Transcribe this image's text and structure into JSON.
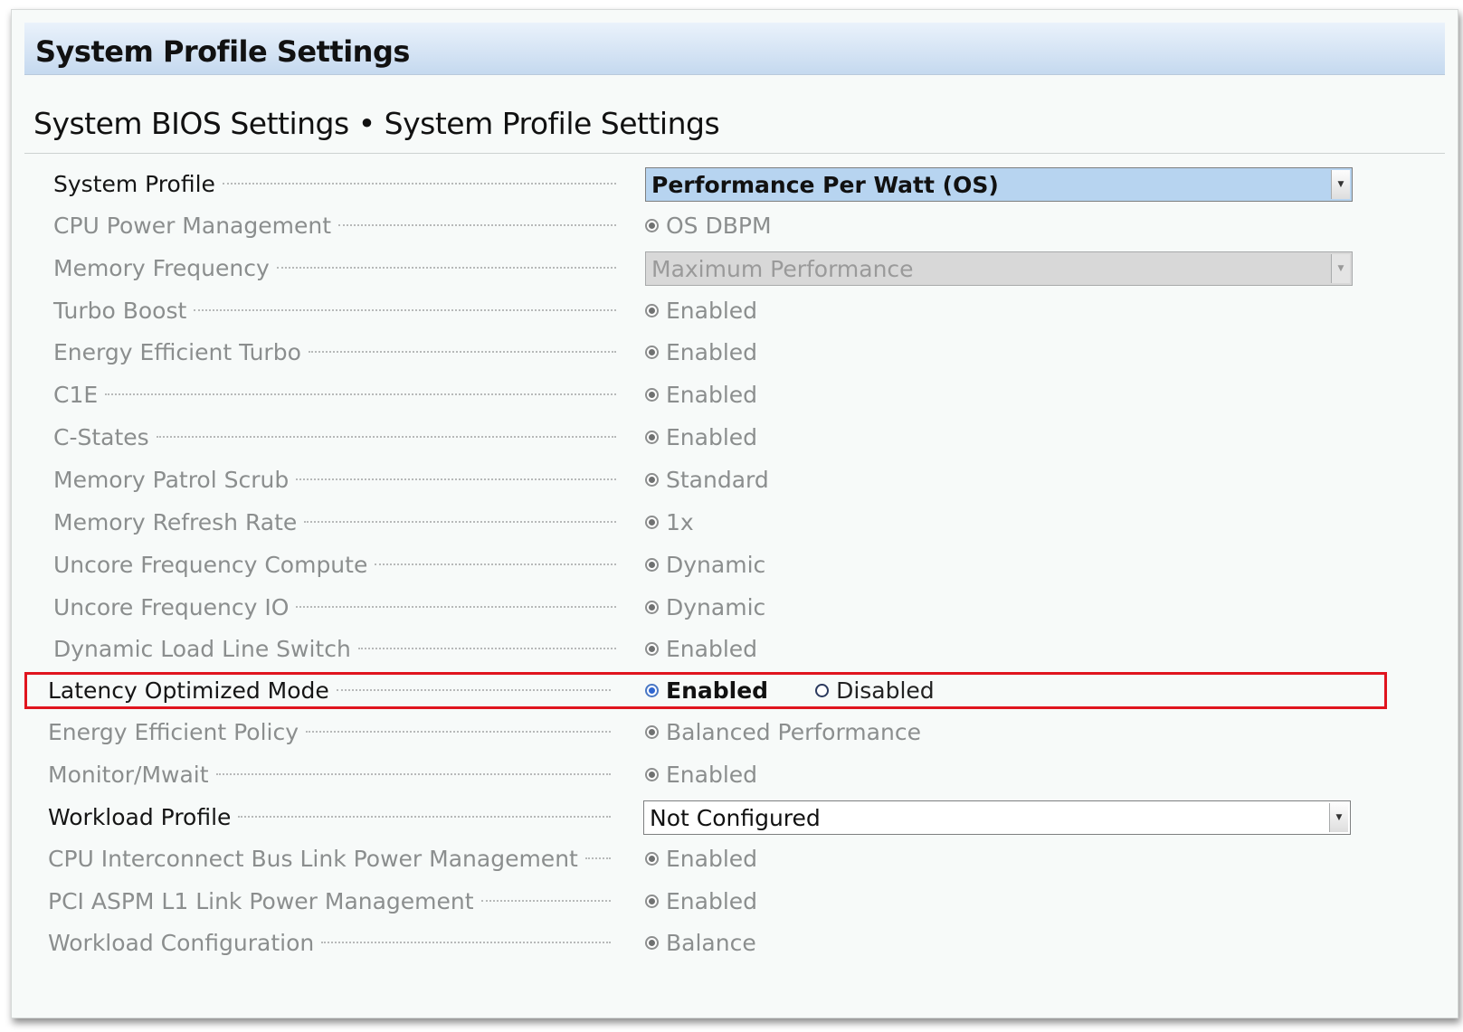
{
  "page": {
    "header_title": "System Profile Settings",
    "breadcrumb": {
      "part1": "System BIOS Settings",
      "separator": "•",
      "part2": "System Profile Settings"
    }
  },
  "settings": {
    "system_profile": {
      "label": "System Profile",
      "value": "Performance Per Watt (OS)"
    },
    "cpu_power_management": {
      "label": "CPU Power Management",
      "value": "OS DBPM"
    },
    "memory_frequency": {
      "label": "Memory Frequency",
      "value": "Maximum Performance"
    },
    "turbo_boost": {
      "label": "Turbo Boost",
      "value": "Enabled"
    },
    "energy_efficient_turbo": {
      "label": "Energy Efficient Turbo",
      "value": "Enabled"
    },
    "c1e": {
      "label": "C1E",
      "value": "Enabled"
    },
    "c_states": {
      "label": "C-States",
      "value": "Enabled"
    },
    "memory_patrol_scrub": {
      "label": "Memory Patrol Scrub",
      "value": "Standard"
    },
    "memory_refresh_rate": {
      "label": "Memory Refresh Rate",
      "value": "1x"
    },
    "uncore_frequency_compute": {
      "label": "Uncore Frequency Compute",
      "value": "Dynamic"
    },
    "uncore_frequency_io": {
      "label": "Uncore Frequency IO",
      "value": "Dynamic"
    },
    "dynamic_load_line_switch": {
      "label": "Dynamic Load Line Switch",
      "value": "Enabled"
    },
    "latency_optimized_mode": {
      "label": "Latency Optimized Mode",
      "option_enabled": "Enabled",
      "option_disabled": "Disabled",
      "selected": "Enabled"
    },
    "energy_efficient_policy": {
      "label": "Energy Efficient Policy",
      "value": "Balanced Performance"
    },
    "monitor_mwait": {
      "label": "Monitor/Mwait",
      "value": "Enabled"
    },
    "workload_profile": {
      "label": "Workload Profile",
      "value": "Not Configured"
    },
    "cpu_interconnect_bus_link_pm": {
      "label": "CPU Interconnect Bus Link Power Management",
      "value": "Enabled"
    },
    "pci_aspm_l1_link_pm": {
      "label": "PCI ASPM L1 Link Power Management",
      "value": "Enabled"
    },
    "workload_configuration": {
      "label": "Workload Configuration",
      "value": "Balance"
    }
  },
  "colors": {
    "highlight_border": "#e0141e",
    "header_gradient_top": "#eaf2fb",
    "header_gradient_bottom": "#c5d9ef",
    "selected_dropdown_bg": "#b7d4f0",
    "disabled_text": "#8b8e8e"
  },
  "icons": {
    "dropdown_arrow": "chevron-down-icon",
    "radio_selected": "radio-selected-icon",
    "radio_unselected": "radio-unselected-icon"
  }
}
